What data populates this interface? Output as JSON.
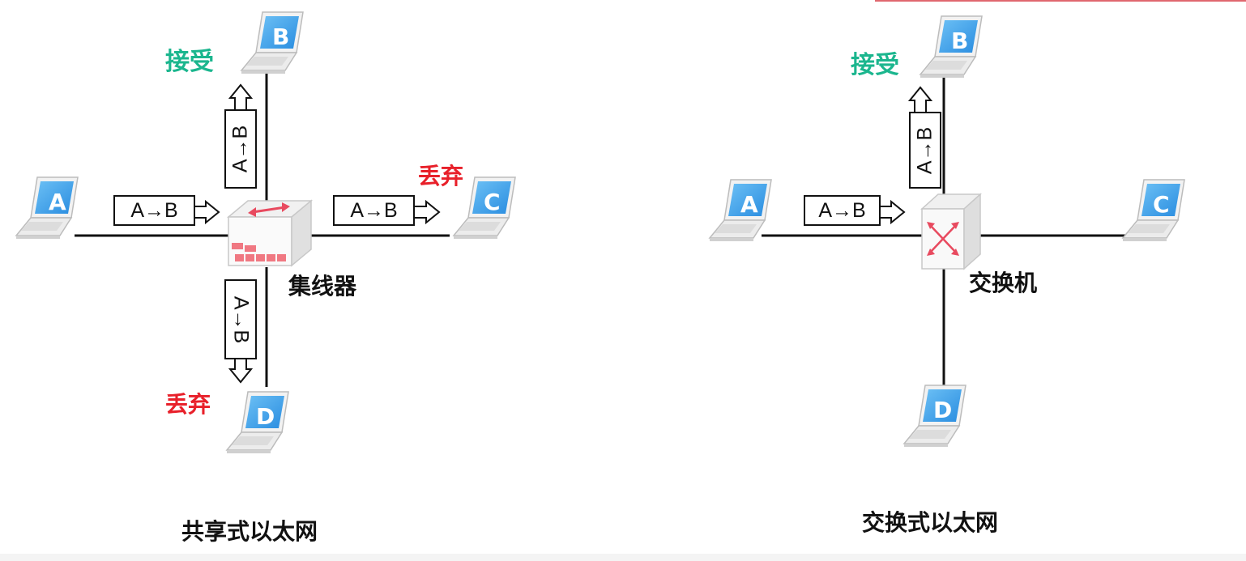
{
  "diagrams": {
    "hub": {
      "device_label": "集线器",
      "caption": "共享式以太网",
      "nodes": {
        "a": "A",
        "b": "B",
        "c": "C",
        "d": "D"
      },
      "status_b": "接受",
      "status_c": "丢弃",
      "status_d": "丢弃",
      "frame_ab": "A→B"
    },
    "switch": {
      "device_label": "交换机",
      "caption": "交换式以太网",
      "nodes": {
        "a": "A",
        "b": "B",
        "c": "C",
        "d": "D"
      },
      "status_b": "接受",
      "frame_ab": "A→B"
    }
  },
  "colors": {
    "accept": "#1bb68e",
    "drop": "#e8202a",
    "laptop_screen": "#3ea0e8",
    "hub_arrow": "#e84a5f"
  },
  "icons": [
    "laptop-icon",
    "hub-icon",
    "switch-icon"
  ]
}
